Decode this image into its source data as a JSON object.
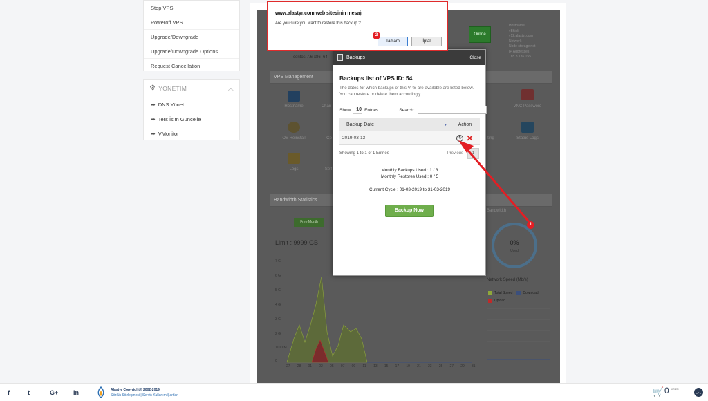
{
  "sidebar": {
    "service_menu": [
      "Stop VPS",
      "Poweroff VPS",
      "Upgrade/Downgrade",
      "Upgrade/Downgrade Options",
      "Request Cancellation"
    ],
    "management": {
      "title": "YÖNETİM",
      "links": [
        "DNS Yönet",
        "Ters İsim Güncelle",
        "VMonitor"
      ]
    }
  },
  "background": {
    "os_label": "centos-7.6-x86_64",
    "vps_management": "VPS Management",
    "online_status": "Online",
    "icon_labels": {
      "hostname": "Hostname",
      "change": "Chan",
      "vnc_password": "VNC Password",
      "os_reinstall": "OS Reinstall",
      "cp": "Cp",
      "ting": "ting",
      "status_logs": "Status Logs",
      "logs": "Logs",
      "self": "Self"
    },
    "server_info": [
      "Hostname",
      "vEkinli",
      "v12.alastyr.com",
      "Netwerk",
      "Node storage.net",
      "IP Addresses",
      "185.8.136.155"
    ],
    "bandwidth_title": "Bandwidth Statistics",
    "bandwidth_right": "Bandwidth",
    "free_month": "Free Month",
    "limit": "Limit : 9999 GB",
    "y_ticks": [
      "7 G",
      "6 G",
      "5 G",
      "4 G",
      "3 G",
      "2 G",
      "1000 M",
      "0"
    ],
    "x_ticks": [
      "27",
      "28",
      "01",
      "02",
      "05",
      "07",
      "09",
      "11",
      "13",
      "15",
      "17",
      "19",
      "21",
      "23",
      "25",
      "27",
      "29",
      "31"
    ],
    "donut_value": "0%",
    "donut_label": "Used",
    "network_speed": "Network Speed (Mb/s)",
    "legend": [
      "Total Speed",
      "Download",
      "Upload"
    ],
    "colors": {
      "total": "#8fa83a",
      "download": "#3b4f7c",
      "upload": "#c02a2a"
    }
  },
  "modal": {
    "header": "Backups",
    "close": "Close",
    "title": "Backups list of VPS ID: 54",
    "description": "The dates for which backups of this VPS are available are listed below. You can restore or delete them accordingly.",
    "show_label": "Show",
    "entries_value": "10",
    "entries_label": "Entries",
    "search_label": "Search:",
    "col_date": "Backup Date",
    "col_action": "Action",
    "rows": [
      {
        "date": "2019-03-13"
      }
    ],
    "showing": "Showing 1 to 1 of 1 Entries",
    "previous": "Previous",
    "page": "1",
    "monthly_backups": "Monthly Backups Used : 1 / 3",
    "monthly_restores": "Monthly Restores Used : 0 / 5",
    "current_cycle": "Current Cycle : 01-03-2019 to 31-03-2019",
    "backup_now": "Backup Now"
  },
  "confirm_dialog": {
    "title": "www.alastyr.com web sitesinin mesajı",
    "message": "Are you sure you want to restore this backup ?",
    "ok": "Tamam",
    "cancel": "İptal"
  },
  "annotations": {
    "badge1": "1",
    "badge2": "2",
    "arrow_color": "#e31e24"
  },
  "footer": {
    "social": [
      "f",
      "t",
      "G+",
      "in"
    ],
    "copyright": "Alastyr Copyright© 2002-2019",
    "links": "Sözlük Sözleşmesi | Servis Kullanım Şartları",
    "cart_count": "0",
    "currency": "ÜRÜN"
  }
}
